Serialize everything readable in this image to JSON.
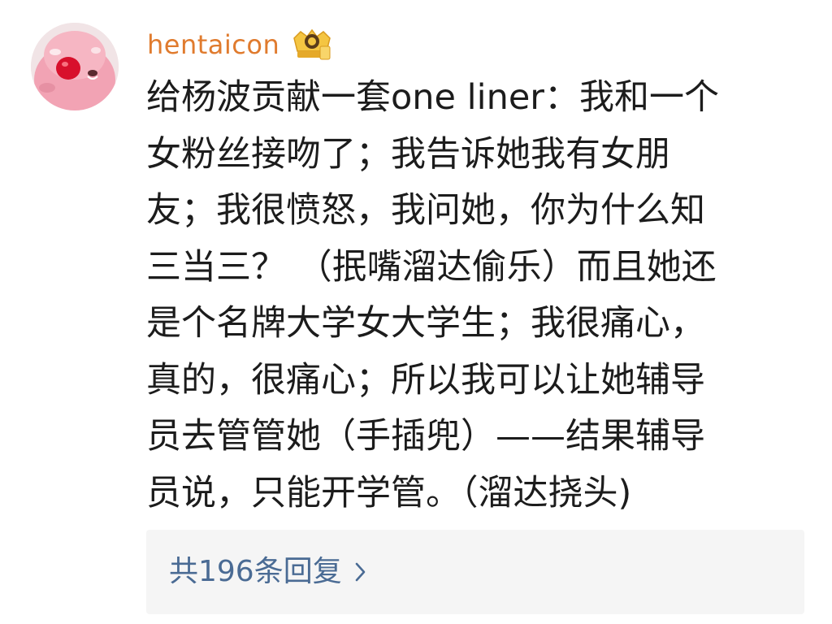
{
  "comment": {
    "username": "hentaicon",
    "body_lines": [
      "给杨波贡献一套one liner：我和一个",
      "女粉丝接吻了；我告诉她我有女朋",
      "友；我很愤怒，我问她，你为什么知",
      "三当三？ （抿嘴溜达偷乐）而且她还",
      "是个名牌大学女大学生；我很痛心，",
      "真的，很痛心；所以我可以让她辅导",
      "员去管管她（手插兜）——结果辅导",
      "员说，只能开学管。（溜达挠头)"
    ],
    "replies_label": "共196条回复",
    "icons": {
      "avatar": "avatar-image",
      "badge": "crown-badge-icon",
      "chevron": "chevron-right-icon"
    }
  },
  "colors": {
    "username": "#e07b2e",
    "body_text": "#1c1c1c",
    "replies_link": "#4a6b94",
    "replies_bg": "#f5f5f5"
  }
}
